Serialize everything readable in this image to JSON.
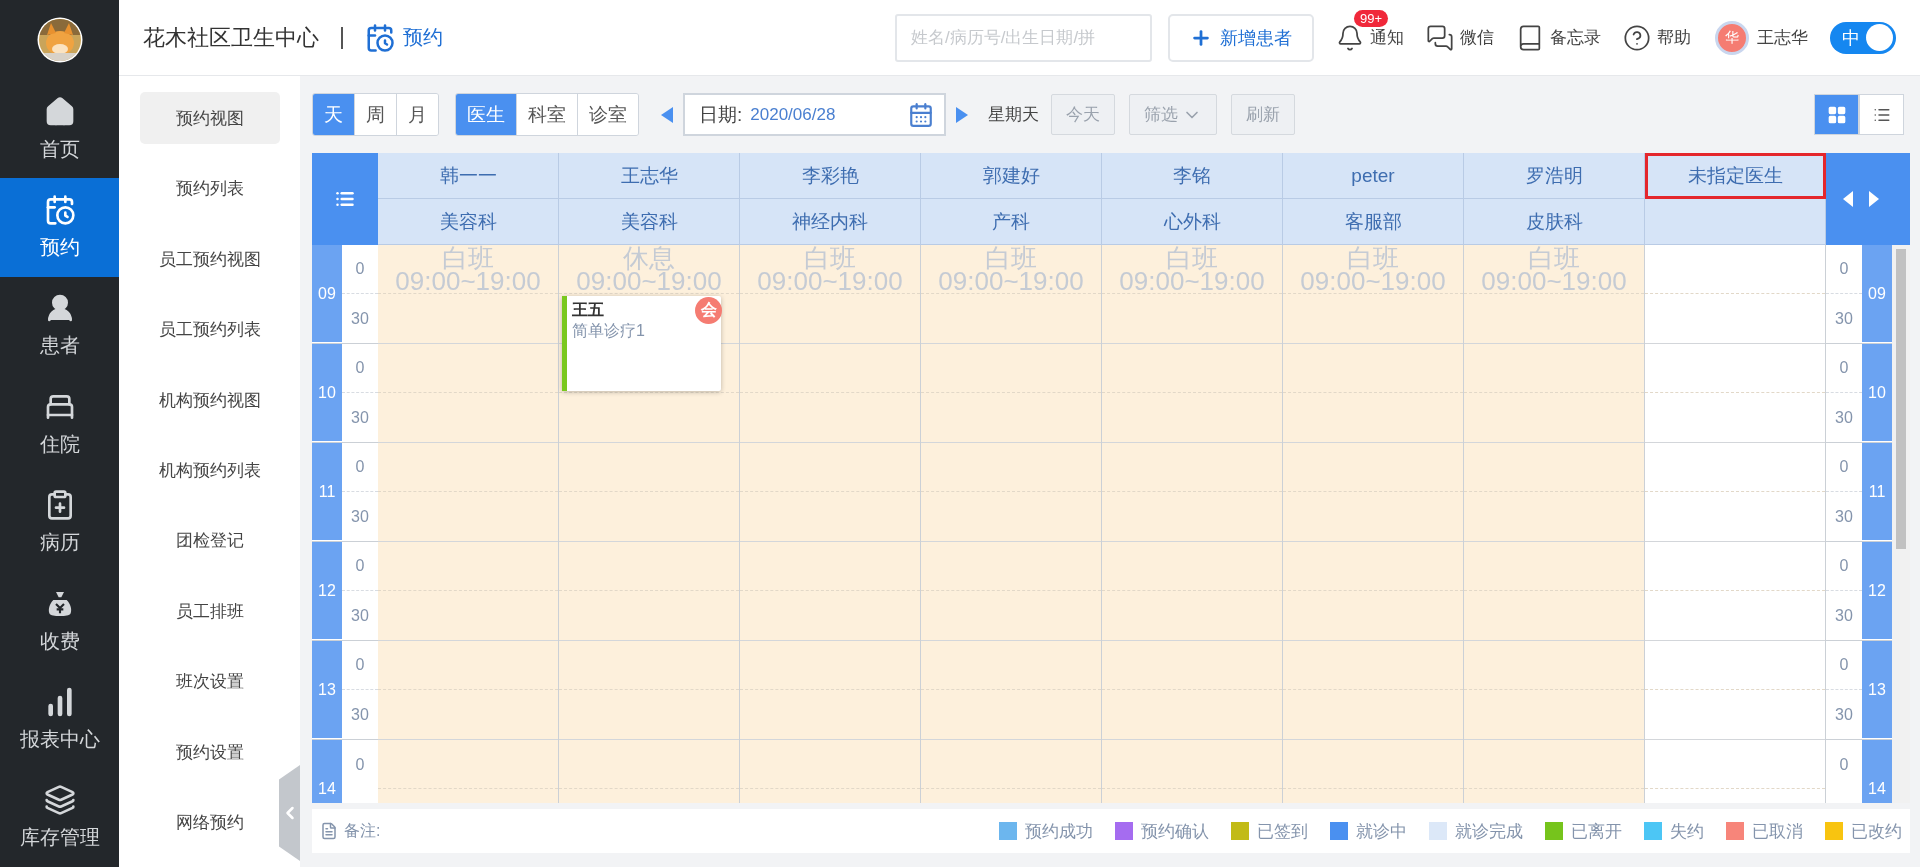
{
  "nav": [
    {
      "label": "首页",
      "kind": "home",
      "selected": false
    },
    {
      "label": "预约",
      "kind": "calendar",
      "selected": true
    },
    {
      "label": "患者",
      "kind": "person",
      "selected": false
    },
    {
      "label": "住院",
      "kind": "bed",
      "selected": false
    },
    {
      "label": "病历",
      "kind": "record",
      "selected": false
    },
    {
      "label": "收费",
      "kind": "money",
      "selected": false
    },
    {
      "label": "报表中心",
      "kind": "chart",
      "selected": false
    },
    {
      "label": "库存管理",
      "kind": "stack",
      "selected": false
    }
  ],
  "header": {
    "clinic": "花木社区卫生中心",
    "module": "预约",
    "search_placeholder": "姓名/病历号/出生日期/拼",
    "add_button": "新增患者",
    "notify": {
      "label": "通知",
      "badge": "99+"
    },
    "wechat": "微信",
    "memo": "备忘录",
    "help": "帮助",
    "user": {
      "avatar": "华",
      "name": "王志华"
    },
    "toggle": {
      "label": "中",
      "on": true
    }
  },
  "submenu": [
    {
      "label": "预约视图",
      "selected": true
    },
    {
      "label": "预约列表",
      "selected": false
    },
    {
      "label": "员工预约视图",
      "selected": false
    },
    {
      "label": "员工预约列表",
      "selected": false
    },
    {
      "label": "机构预约视图",
      "selected": false
    },
    {
      "label": "机构预约列表",
      "selected": false
    },
    {
      "label": "团检登记",
      "selected": false
    },
    {
      "label": "员工排班",
      "selected": false
    },
    {
      "label": "班次设置",
      "selected": false
    },
    {
      "label": "预约设置",
      "selected": false
    },
    {
      "label": "网络预约",
      "selected": false
    }
  ],
  "toolbar": {
    "range_tabs": [
      {
        "label": "天",
        "selected": true
      },
      {
        "label": "周",
        "selected": false
      },
      {
        "label": "月",
        "selected": false
      }
    ],
    "group_tabs": [
      {
        "label": "医生",
        "selected": true
      },
      {
        "label": "科室",
        "selected": false
      },
      {
        "label": "诊室",
        "selected": false
      }
    ],
    "date": {
      "label": "日期:",
      "value": "2020/06/28"
    },
    "weekday": "星期天",
    "today": "今天",
    "filter": "筛选",
    "refresh": "刷新",
    "views": [
      {
        "kind": "grid",
        "selected": true
      },
      {
        "kind": "list",
        "selected": false
      }
    ]
  },
  "schedule": {
    "doctors": [
      {
        "name": "韩一一",
        "dept": "美容科",
        "shift": "白班",
        "hours": "09:00~19:00",
        "highlighted": false
      },
      {
        "name": "王志华",
        "dept": "美容科",
        "shift": "休息",
        "hours": "09:00~19:00",
        "highlighted": false,
        "appointments": [
          {
            "patient": "王五",
            "service": "简单诊疗1",
            "badge": "会",
            "color": "#7ac81e"
          }
        ]
      },
      {
        "name": "李彩艳",
        "dept": "神经内科",
        "shift": "白班",
        "hours": "09:00~19:00",
        "highlighted": false
      },
      {
        "name": "郭建好",
        "dept": "产科",
        "shift": "白班",
        "hours": "09:00~19:00",
        "highlighted": false
      },
      {
        "name": "李铭",
        "dept": "心外科",
        "shift": "白班",
        "hours": "09:00~19:00",
        "highlighted": false
      },
      {
        "name": "peter",
        "dept": "客服部",
        "shift": "白班",
        "hours": "09:00~19:00",
        "highlighted": false
      },
      {
        "name": "罗浩明",
        "dept": "皮肤科",
        "shift": "白班",
        "hours": "09:00~19:00",
        "highlighted": false
      },
      {
        "name": "未指定医生",
        "highlighted": true
      }
    ],
    "hours": [
      {
        "left_label": "09",
        "left_marks": [
          "0",
          "30"
        ],
        "right_marks": [
          "0",
          "30"
        ],
        "right_label": "09"
      },
      {
        "left_label": "10",
        "left_marks": [
          "0",
          "30"
        ],
        "right_marks": [
          "0",
          "30"
        ],
        "right_label": "10"
      },
      {
        "left_label": "11",
        "left_marks": [
          "0",
          "30"
        ],
        "right_marks": [
          "0",
          "30"
        ],
        "right_label": "11"
      },
      {
        "left_label": "12",
        "left_marks": [
          "0",
          "30"
        ],
        "right_marks": [
          "0",
          "30"
        ],
        "right_label": "12"
      },
      {
        "left_label": "13",
        "left_marks": [
          "0",
          "30"
        ],
        "right_marks": [
          "0",
          "30"
        ],
        "right_label": "13"
      },
      {
        "left_label": "14",
        "left_marks": [
          "0"
        ],
        "right_marks": [
          "0"
        ],
        "right_label": "14"
      }
    ]
  },
  "legend": {
    "label": "备注:",
    "items": [
      {
        "label": "预约成功",
        "color": "#6cb6ee"
      },
      {
        "label": "预约确认",
        "color": "#a56cf0"
      },
      {
        "label": "已签到",
        "color": "#c2bb16"
      },
      {
        "label": "就诊中",
        "color": "#4a90f0"
      },
      {
        "label": "就诊完成",
        "color": "#dce8f8"
      },
      {
        "label": "已离开",
        "color": "#76c41c"
      },
      {
        "label": "失约",
        "color": "#4cc6f5"
      },
      {
        "label": "已取消",
        "color": "#f7857a"
      },
      {
        "label": "已改约",
        "color": "#f8c410"
      }
    ]
  }
}
